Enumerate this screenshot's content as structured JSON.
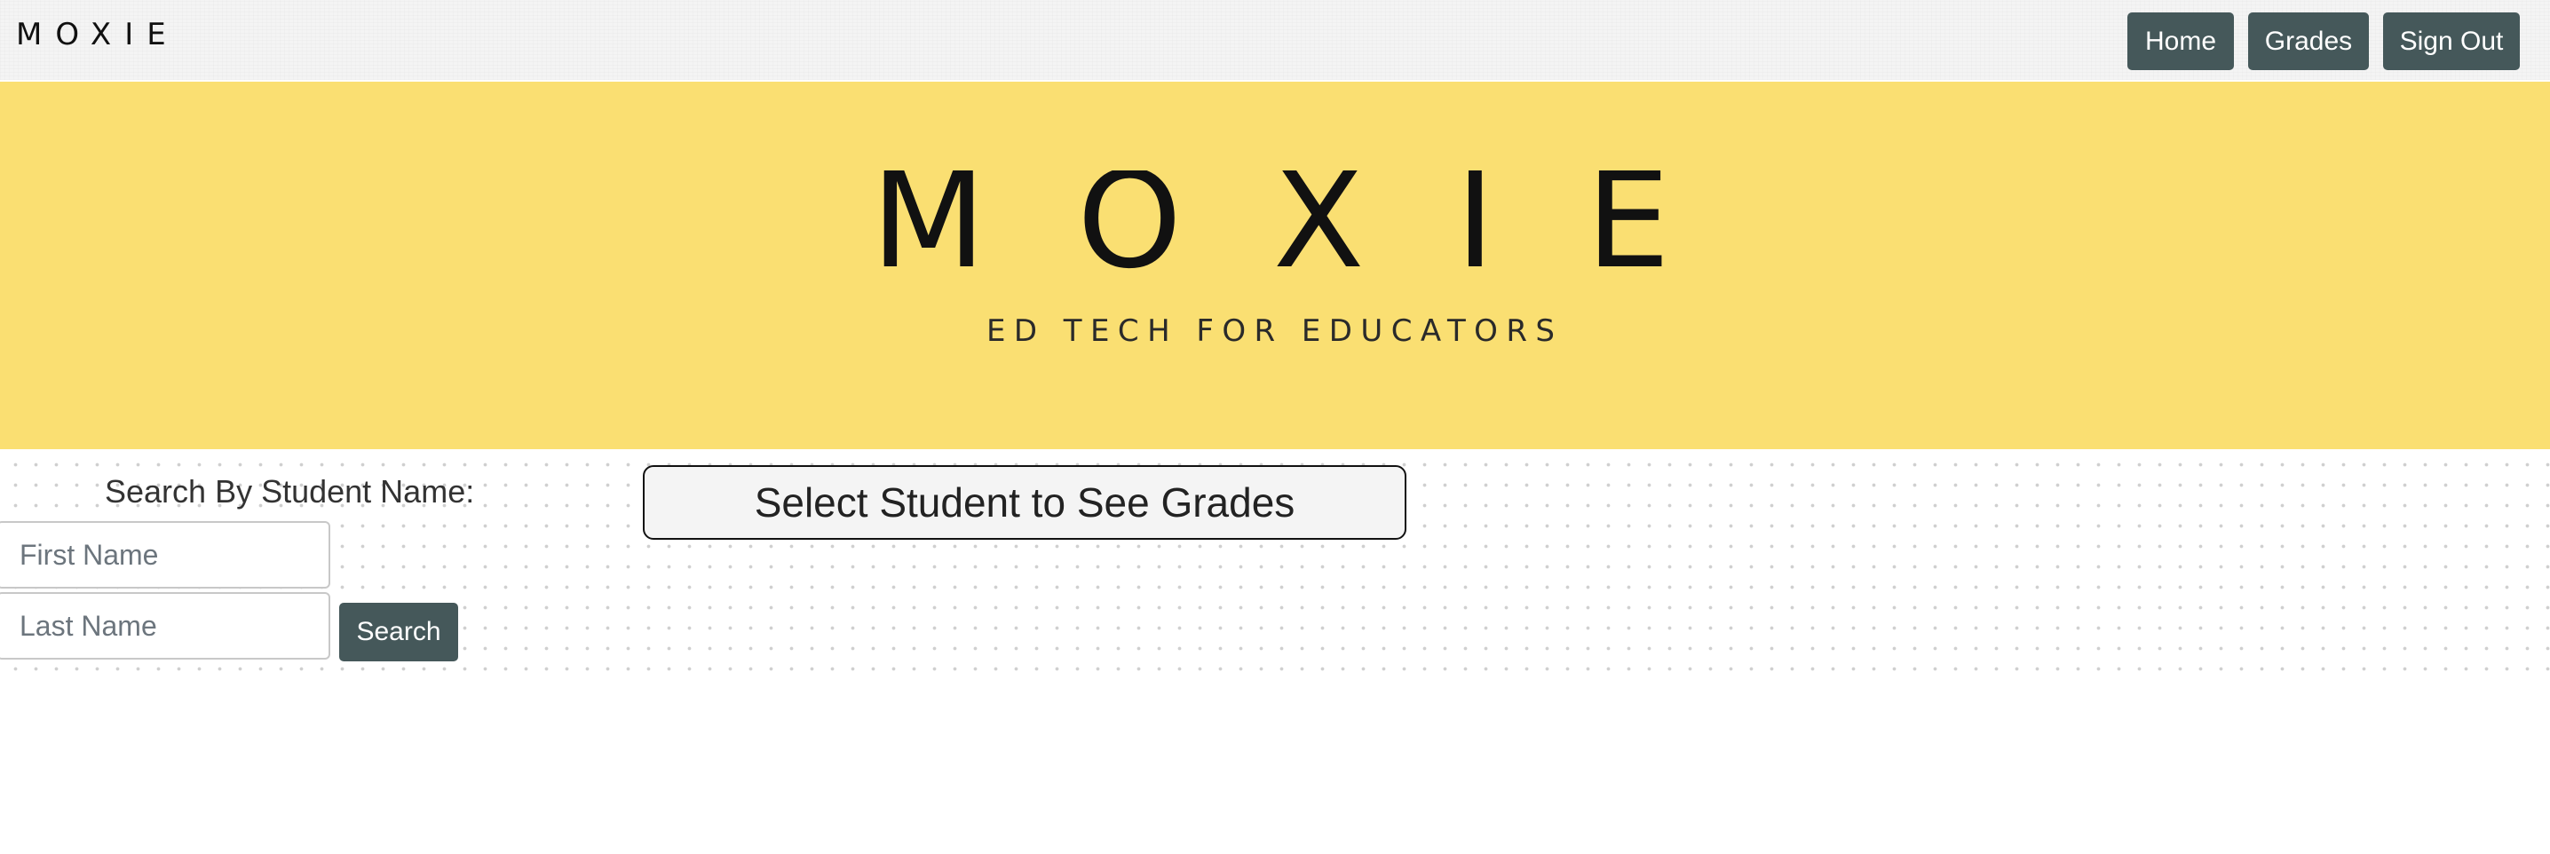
{
  "navbar": {
    "brand": "MOXIE",
    "buttons": [
      {
        "label": "Home"
      },
      {
        "label": "Grades"
      },
      {
        "label": "Sign Out"
      }
    ]
  },
  "hero": {
    "logo_title": "M O X I E",
    "logo_tagline": "ED TECH FOR EDUCATORS"
  },
  "search": {
    "label": "Search By Student Name:",
    "first_name_placeholder": "First Name",
    "first_name_value": "",
    "last_name_placeholder": "Last Name",
    "last_name_value": "",
    "button_label": "Search"
  },
  "grades_panel": {
    "prompt": "Select Student to See Grades"
  },
  "colors": {
    "hero_background": "#fadf72",
    "button_background": "#45585a",
    "navbar_background": "#f4f4f4"
  }
}
